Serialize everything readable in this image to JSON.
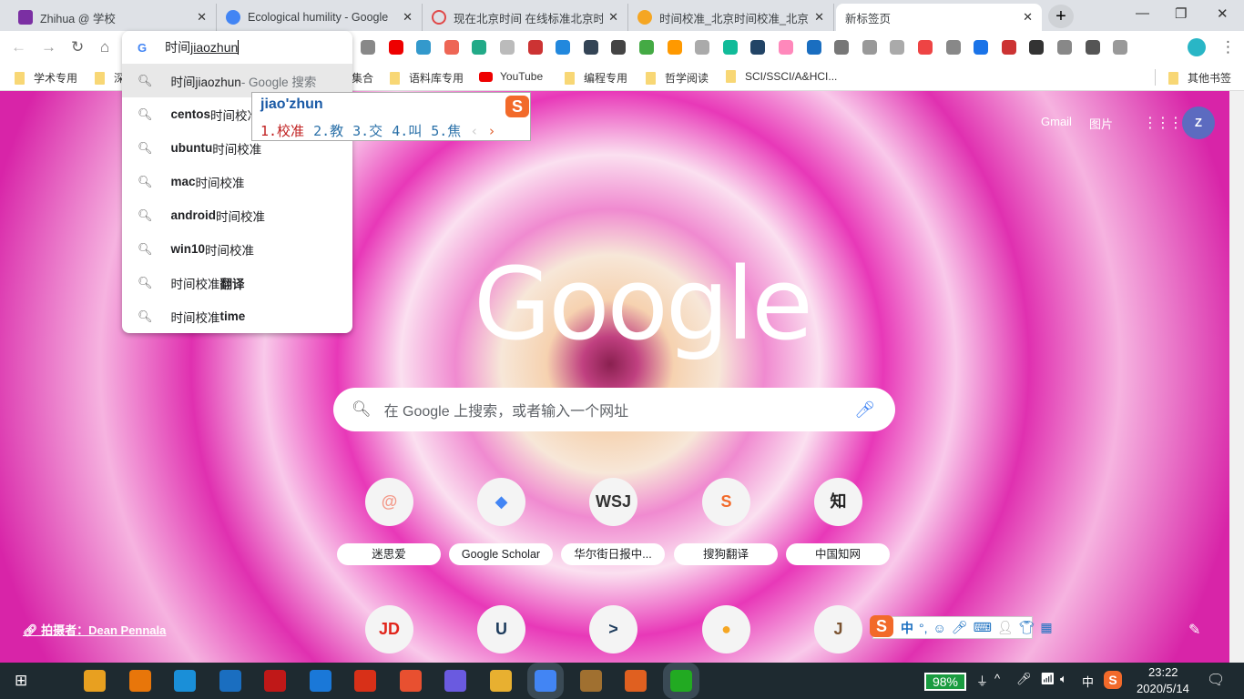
{
  "tabs": [
    {
      "title": "Zhihua @ 学校",
      "favicon": "onenote-icon",
      "color": "#7b2fa3"
    },
    {
      "title": "Ecological humility - Google",
      "favicon": "google-scholar-icon",
      "color": "#4285f4"
    },
    {
      "title": "现在北京时间 在线标准北京时",
      "favicon": "clock-icon",
      "color": "#e04848"
    },
    {
      "title": "时间校准_北京时间校准_北京时",
      "favicon": "site-icon",
      "color": "#f5a623"
    },
    {
      "title": "新标签页",
      "favicon": "",
      "active": true
    }
  ],
  "omnibox": {
    "typed": "时间",
    "composing": "jiaozhun",
    "suggestions": [
      {
        "bold": "",
        "normal": "时间jiaozhun",
        "suffix": " - Google 搜索"
      },
      {
        "bold": "centos",
        "normal": " 时间校准"
      },
      {
        "bold": "ubuntu",
        "normal": " 时间校准"
      },
      {
        "bold": "mac",
        "normal": " 时间校准"
      },
      {
        "bold": "android",
        "normal": " 时间校准"
      },
      {
        "bold": "win10",
        "normal": " 时间校准"
      },
      {
        "bold": " 翻译",
        "normal": "时间校准"
      },
      {
        "bold": " time",
        "normal": "时间校准"
      }
    ]
  },
  "ime": {
    "pinyin": "jiao'zhun",
    "candidates": [
      "1.校准",
      "2.教",
      "3.交",
      "4.叫",
      "5.焦"
    ],
    "status_lang": "中"
  },
  "bookmarks": [
    {
      "label": "学术专用",
      "type": "folder"
    },
    {
      "label": "深",
      "type": "folder"
    },
    {
      "label": "集合",
      "type": "folder"
    },
    {
      "label": "语料库专用",
      "type": "folder"
    },
    {
      "label": "YouTube",
      "type": "youtube"
    },
    {
      "label": "编程专用",
      "type": "folder"
    },
    {
      "label": "哲学阅读",
      "type": "folder"
    },
    {
      "label": "SCI/SSCI/A&HCI...",
      "type": "folder"
    },
    {
      "label": "其他书签",
      "type": "folder"
    }
  ],
  "ntp": {
    "gmail": "Gmail",
    "images": "图片",
    "avatar": "Z",
    "search_placeholder": "在 Google 上搜索，或者输入一个网址",
    "logo": "Google",
    "shortcuts": [
      {
        "label": "迷思爱",
        "glyph": "@",
        "color": "#f39a8a"
      },
      {
        "label": "Google Scholar",
        "glyph": "◆",
        "color": "#4285f4"
      },
      {
        "label": "华尔街日报中...",
        "glyph": "WSJ",
        "color": "#333"
      },
      {
        "label": "搜狗翻译",
        "glyph": "S",
        "color": "#f26a2a"
      },
      {
        "label": "中国知网",
        "glyph": "知",
        "color": "#222"
      },
      {
        "label": "",
        "glyph": "JD",
        "color": "#e1251b"
      },
      {
        "label": "",
        "glyph": "U",
        "color": "#1d3b5c"
      },
      {
        "label": "",
        "glyph": ">",
        "color": "#1d3b5c"
      },
      {
        "label": "",
        "glyph": "●",
        "color": "#f5a623"
      },
      {
        "label": "",
        "glyph": "J",
        "color": "#7a5230"
      }
    ],
    "credit": "拍摄者：Dean Pennala"
  },
  "taskbar": {
    "battery": "98%",
    "time": "23:22",
    "date": "2020/5/14",
    "lang": "中"
  }
}
